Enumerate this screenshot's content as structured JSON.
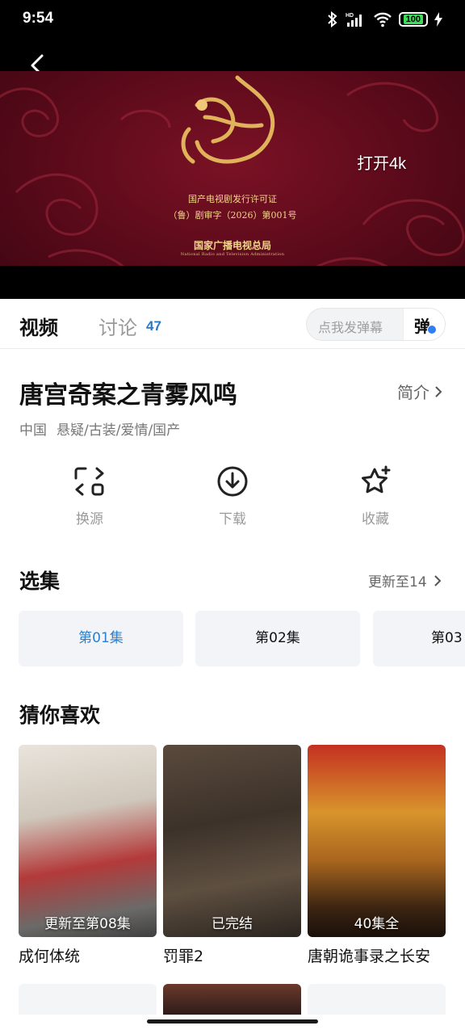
{
  "status_bar": {
    "time": "9:54",
    "battery": "100",
    "hd_label": "HD"
  },
  "player": {
    "open_4k": "打开4k",
    "license": {
      "line1": "国产电视剧发行许可证",
      "line2": "（鲁）剧审字（2026）第001号",
      "authority": "国家广播电视总局",
      "authority_en": "National Radio and Television Administration"
    }
  },
  "tabs": {
    "video": "视频",
    "discussion": "讨论",
    "discussion_count": "47",
    "danmu_placeholder": "点我发弹幕",
    "danmu_button": "弹"
  },
  "show": {
    "title": "唐宫奇案之青雾风鸣",
    "intro": "简介",
    "region": "中国",
    "genres": "悬疑/古装/爱情/国产"
  },
  "actions": [
    {
      "label": "换源",
      "icon": "switch-source-icon"
    },
    {
      "label": "下载",
      "icon": "download-icon"
    },
    {
      "label": "收藏",
      "icon": "favorite-star-icon"
    }
  ],
  "episodes": {
    "title": "选集",
    "update": "更新至14",
    "items": [
      "第01集",
      "第02集",
      "第03"
    ]
  },
  "recommend": {
    "title": "猜你喜欢",
    "items": [
      {
        "name": "成何体统",
        "badge": "更新至第08集"
      },
      {
        "name": "罚罪2",
        "badge": "已完结"
      },
      {
        "name": "唐朝诡事录之长安",
        "badge": "40集全"
      }
    ]
  },
  "colors": {
    "accent": "#2a7fd0",
    "badge_blue": "#2f7ff2",
    "battery_green": "#3ddc5a"
  }
}
